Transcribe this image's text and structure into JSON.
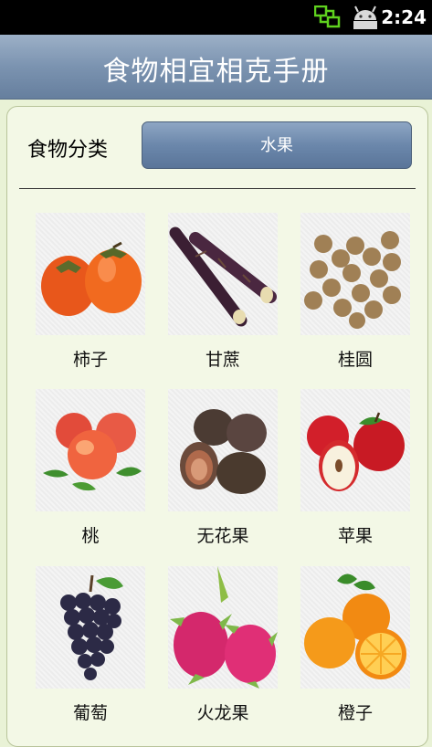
{
  "status_bar": {
    "time": "2:24",
    "icons": [
      "network-sync-icon",
      "android-usb-icon"
    ]
  },
  "app": {
    "title": "食物相宜相克手册"
  },
  "category": {
    "label": "食物分类",
    "selected": "水果"
  },
  "items": [
    {
      "name": "柿子",
      "icon": "persimmon-image"
    },
    {
      "name": "甘蔗",
      "icon": "sugarcane-image"
    },
    {
      "name": "桂圆",
      "icon": "longan-image"
    },
    {
      "name": "桃",
      "icon": "peach-image"
    },
    {
      "name": "无花果",
      "icon": "fig-image"
    },
    {
      "name": "苹果",
      "icon": "apple-image"
    },
    {
      "name": "葡萄",
      "icon": "grape-image"
    },
    {
      "name": "火龙果",
      "icon": "dragon-fruit-image"
    },
    {
      "name": "橙子",
      "icon": "orange-image"
    }
  ]
}
